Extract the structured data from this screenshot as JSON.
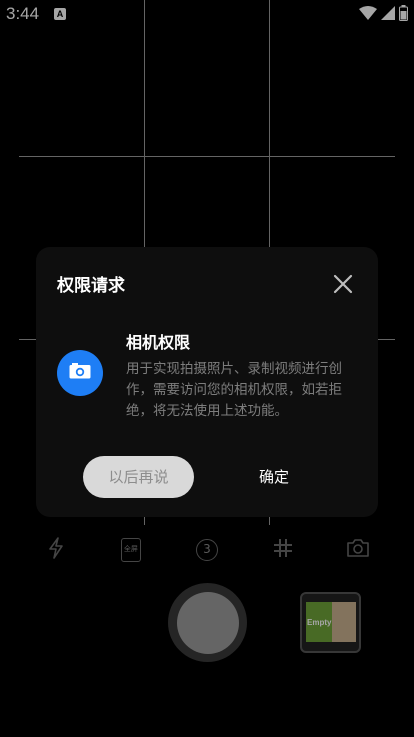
{
  "status_bar": {
    "time": "3:44",
    "notification_badge": "A",
    "icons": [
      "wifi-icon",
      "signal-icon",
      "battery-icon"
    ]
  },
  "camera": {
    "grid": "on",
    "toolbar_icons": [
      "flash-icon",
      "fullscreen-ratio-icon",
      "timer-icon",
      "grid-icon",
      "switch-camera-icon"
    ],
    "ratio_label": "全屏",
    "timer_label": "3",
    "thumbnail_text": "Empty"
  },
  "dialog": {
    "title": "权限请求",
    "permission_title": "相机权限",
    "permission_description": "用于实现拍摄照片、录制视频进行创作，需要访问您的相机权限，如若拒绝，将无法使用上述功能。",
    "later_button": "以后再说",
    "confirm_button": "确定"
  },
  "colors": {
    "accent": "#1e7ef5",
    "dialog_bg": "#0e0e0e",
    "secondary_text": "#7d7d7d"
  }
}
